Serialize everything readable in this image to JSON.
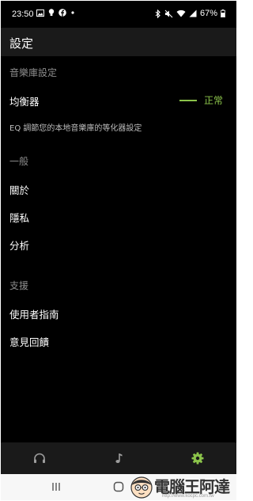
{
  "status_bar": {
    "time": "23:50",
    "battery": "67%",
    "left_icons": [
      "image-icon",
      "bulb-icon",
      "facebook-icon",
      "dot-icon"
    ],
    "right_icons": [
      "bluetooth-icon",
      "mute-icon",
      "wifi-icon",
      "signal-icon",
      "battery-icon"
    ]
  },
  "app_bar": {
    "title": "設定"
  },
  "sections": {
    "library": {
      "header": "音樂庫設定",
      "equalizer_label": "均衡器",
      "equalizer_value": "正常",
      "equalizer_desc": "EQ 調節您的本地音樂庫的等化器設定"
    },
    "general": {
      "header": "一般",
      "items": [
        "關於",
        "隱私",
        "分析"
      ]
    },
    "support": {
      "header": "支援",
      "items": [
        "使用者指南",
        "意見回饋"
      ]
    }
  },
  "bottom_nav": {
    "items": [
      {
        "icon": "headphones-icon",
        "active": false
      },
      {
        "icon": "music-note-icon",
        "active": false
      },
      {
        "icon": "gear-icon",
        "active": true
      }
    ],
    "active_color": "#8bc34a",
    "inactive_color": "#9e9e9e"
  },
  "system_nav": {
    "buttons": [
      "recent-apps-icon",
      "home-icon",
      "back-icon"
    ]
  },
  "watermark": {
    "text": "電腦王阿達",
    "url": "http://www.kocpc.com.tw"
  },
  "colors": {
    "accent": "#8bc34a",
    "background": "#000000",
    "bar": "#1a1a1a"
  }
}
